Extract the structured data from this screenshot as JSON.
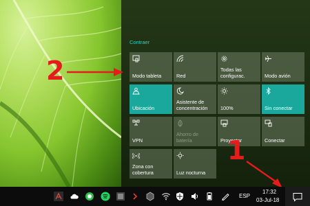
{
  "action_center": {
    "collapse_label": "Contraer",
    "tiles": [
      {
        "label": "Modo tableta",
        "icon": "tablet-mode-icon",
        "active": false
      },
      {
        "label": "Red",
        "icon": "network-icon",
        "active": false
      },
      {
        "label": "Todas las configurac.",
        "icon": "settings-icon",
        "active": false
      },
      {
        "label": "Modo avión",
        "icon": "airplane-icon",
        "active": false
      },
      {
        "label": "Ubicación",
        "icon": "location-icon",
        "active": true
      },
      {
        "label": "Asistente de concentración",
        "icon": "moon-icon",
        "active": false
      },
      {
        "label": "100%",
        "icon": "brightness-icon",
        "active": false
      },
      {
        "label": "Sin conectar",
        "icon": "bluetooth-icon",
        "active": true
      },
      {
        "label": "VPN",
        "icon": "vpn-icon",
        "active": false
      },
      {
        "label": "Ahorro de batería",
        "icon": "battery-saver-icon",
        "active": false,
        "disabled": true
      },
      {
        "label": "Proyectar",
        "icon": "project-icon",
        "active": false
      },
      {
        "label": "Conectar",
        "icon": "connect-icon",
        "active": false
      },
      {
        "label": "Zona con cobertura",
        "icon": "hotspot-icon",
        "active": false
      },
      {
        "label": "Luz nocturna",
        "icon": "night-light-icon",
        "active": false
      }
    ]
  },
  "annotations": {
    "num_2": "2",
    "num_1": "1"
  },
  "taskbar": {
    "language": "ESP",
    "time": "17:32",
    "date": "03-Jul-18"
  },
  "colors": {
    "accent": "#19a89b",
    "tile": "#6e7d64",
    "annotation": "#e61c1c",
    "link": "#2fd1c5"
  }
}
